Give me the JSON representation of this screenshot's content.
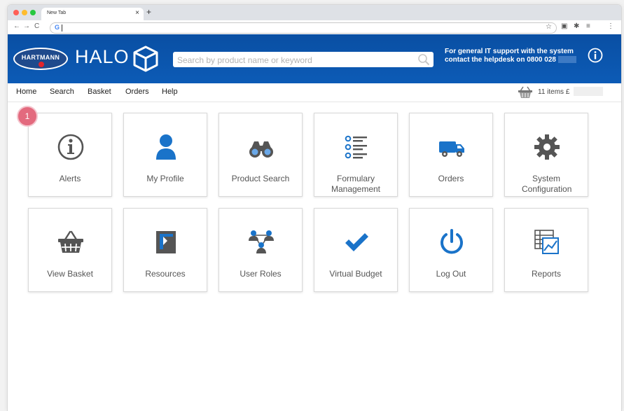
{
  "browser": {
    "tab_title": "New Tab",
    "tab_close": "×",
    "new_tab": "+",
    "address_g": "G"
  },
  "header": {
    "brand_logo_text": "HARTMANN",
    "app_name": "HALO",
    "search_placeholder": "Search by product name or keyword",
    "support_line1": "For general IT support with the system",
    "support_line2": "contact the helpdesk on 0800 028"
  },
  "menu": {
    "items": [
      "Home",
      "Search",
      "Basket",
      "Orders",
      "Help"
    ],
    "basket_summary": "11 items £"
  },
  "alerts_badge": "1",
  "tiles": [
    {
      "label": "Alerts",
      "icon": "info-circle-icon"
    },
    {
      "label": "My Profile",
      "icon": "user-icon"
    },
    {
      "label": "Product Search",
      "icon": "binoculars-icon"
    },
    {
      "label": "Formulary Management",
      "icon": "list-icon"
    },
    {
      "label": "Orders",
      "icon": "truck-icon"
    },
    {
      "label": "System Configuration",
      "icon": "gear-icon"
    },
    {
      "label": "View Basket",
      "icon": "basket-icon"
    },
    {
      "label": "Resources",
      "icon": "document-icon"
    },
    {
      "label": "User Roles",
      "icon": "users-network-icon"
    },
    {
      "label": "Virtual Budget",
      "icon": "checkmark-icon"
    },
    {
      "label": "Log Out",
      "icon": "power-icon"
    },
    {
      "label": "Reports",
      "icon": "report-chart-icon"
    }
  ],
  "colors": {
    "header_blue": "#0c56ad",
    "tile_icon_blue": "#1a73c9",
    "tile_icon_gray": "#555555",
    "badge_pink": "#e36a7e"
  }
}
